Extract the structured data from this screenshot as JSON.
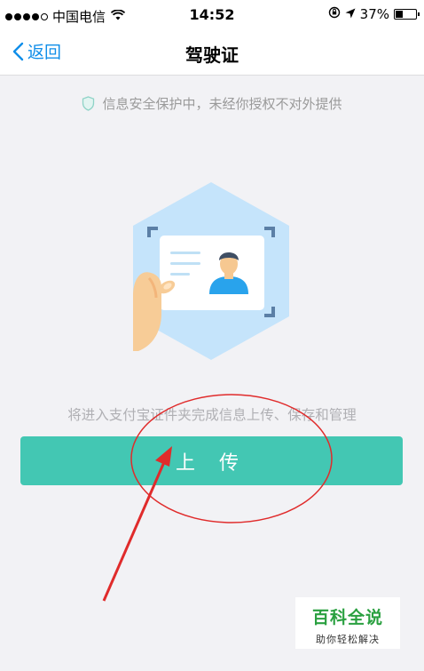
{
  "status_bar": {
    "carrier": "中国电信",
    "time": "14:52",
    "battery": "37%",
    "battery_level": 0.37
  },
  "nav": {
    "back_label": "返回",
    "title": "驾驶证"
  },
  "notice": {
    "text": "信息安全保护中，未经你授权不对外提供"
  },
  "main": {
    "description": "将进入支付宝证件夹完成信息上传、保存和管理",
    "upload_label": "上 传"
  },
  "watermark": {
    "title": "百科全说",
    "subtitle": "助你轻松解决"
  },
  "colors": {
    "accent": "#43c7b3",
    "link": "#108ee9",
    "annotation": "#e02b2b",
    "watermark": "#2aa040"
  }
}
